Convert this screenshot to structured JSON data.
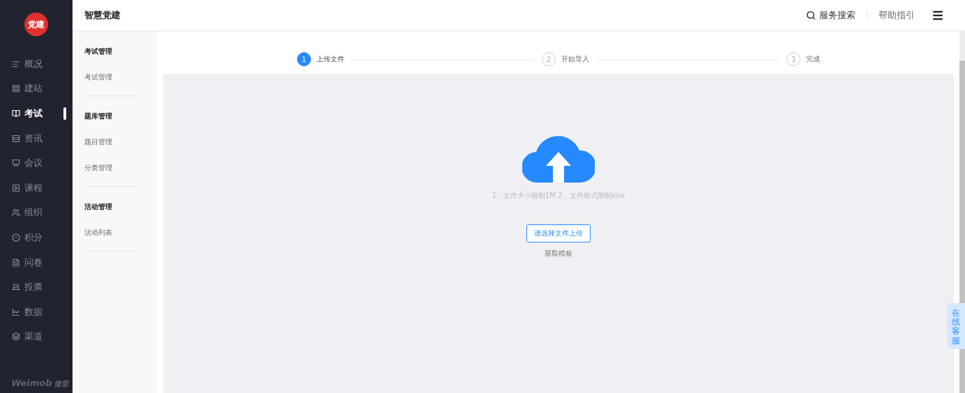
{
  "app": {
    "logo": "党建",
    "title": "智慧党建",
    "brand": "Weimob",
    "brand_suffix": "微盟"
  },
  "nav": [
    {
      "label": "概况",
      "selected": false
    },
    {
      "label": "建站",
      "selected": false
    },
    {
      "label": "考试",
      "selected": true
    },
    {
      "label": "资讯",
      "selected": false
    },
    {
      "label": "会议",
      "selected": false
    },
    {
      "label": "课程",
      "selected": false
    },
    {
      "label": "组织",
      "selected": false
    },
    {
      "label": "积分",
      "selected": false
    },
    {
      "label": "问卷",
      "selected": false
    },
    {
      "label": "投票",
      "selected": false
    },
    {
      "label": "数据",
      "selected": false
    },
    {
      "label": "渠道",
      "selected": false
    }
  ],
  "header": {
    "search": "服务搜索",
    "help": "帮助指引"
  },
  "submenu": [
    {
      "heading": "考试管理",
      "items": [
        "考试管理"
      ]
    },
    {
      "heading": "题库管理",
      "items": [
        "题目管理",
        "分类管理"
      ]
    },
    {
      "heading": "活动管理",
      "items": [
        "活动列表"
      ]
    }
  ],
  "steps": [
    {
      "number": "1",
      "label": "上传文件",
      "active": true
    },
    {
      "number": "2",
      "label": "开始导入",
      "active": false
    },
    {
      "number": "3",
      "label": "完成",
      "active": false
    }
  ],
  "upload": {
    "hint": "1、文件大小限制1M 2、文件格式限制xlsx",
    "button": "请选择文件上传",
    "link": "获取模板"
  },
  "chat_tab": "在线客服"
}
